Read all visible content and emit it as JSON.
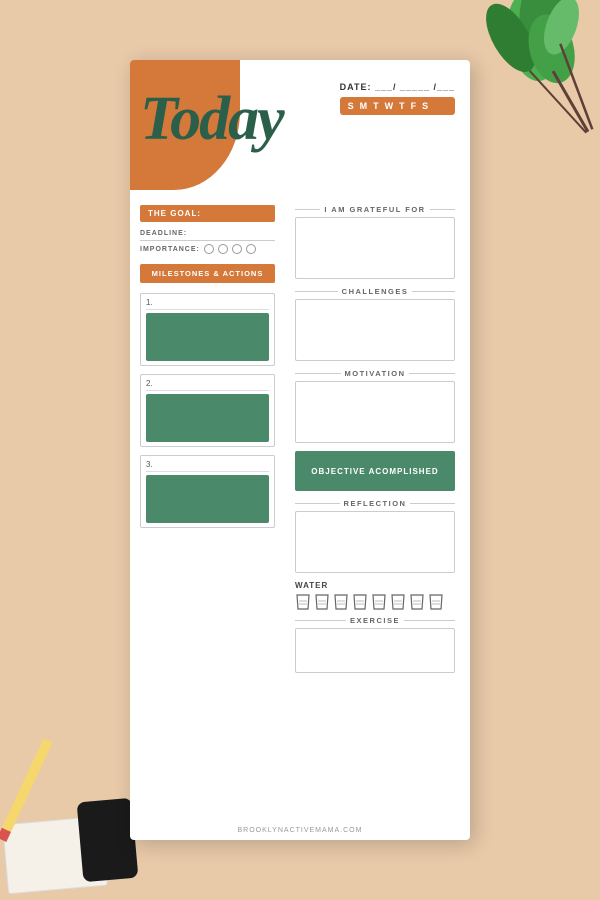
{
  "background": {
    "color": "#E8C9A8"
  },
  "paper": {
    "title": "Today",
    "date_label": "DATE: ___/ _____ /___",
    "days": [
      "S",
      "M",
      "T",
      "W",
      "T",
      "F",
      "S"
    ],
    "left": {
      "goal_label": "THE GOAL:",
      "deadline_label": "DEADLINE:",
      "importance_label": "IMPORTANCE:",
      "milestones_label": "MILESTONES & ACTIONS",
      "milestone1_num": "1.",
      "milestone2_num": "2.",
      "milestone3_num": "3."
    },
    "right": {
      "grateful_label": "I AM GRATEFUL FOR",
      "challenges_label": "CHALLENGES",
      "motivation_label": "MOTIVATION",
      "objective_label": "OBJECTIVE ACOMPLISHED",
      "reflection_label": "REFLECTION",
      "water_label": "WATER",
      "exercise_label": "EXERCISE"
    },
    "footer": "BROOKLYNACTIVEMAMA.COM"
  },
  "colors": {
    "orange": "#D4793A",
    "green": "#4A8A6A",
    "dark_green": "#2C5F4A"
  }
}
